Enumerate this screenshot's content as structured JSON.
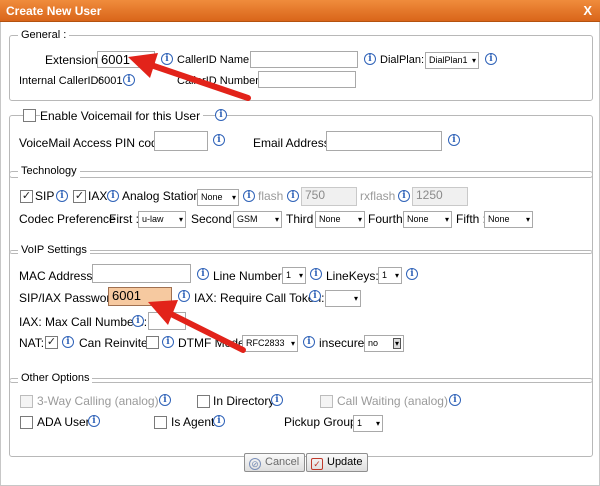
{
  "window": {
    "title": "Create New User",
    "close": "X"
  },
  "general": {
    "legend": "General :",
    "extension_label": "Extension:",
    "extension_value": "6001",
    "callerid_name_label": "CallerID Name:",
    "callerid_name_value": "",
    "dialplan_label": "DialPlan:",
    "dialplan_value": "DialPlan1",
    "internal_callerid_label": "Internal CallerID:",
    "internal_callerid_value": "6001",
    "callerid_number_label": "CallerID Number:",
    "callerid_number_value": ""
  },
  "voicemail": {
    "enable_label": "Enable Voicemail for this User",
    "pin_label": "VoiceMail Access PIN code:",
    "pin_value": "",
    "email_label": "Email Address:",
    "email_value": ""
  },
  "technology": {
    "legend": "Technology",
    "sip_label": "SIP",
    "sip_checked": true,
    "iax_label": "IAX",
    "iax_checked": true,
    "analog_label": "Analog Station:",
    "analog_value": "None",
    "flash_label": "flash",
    "flash_value": "750",
    "rxflash_label": "rxflash",
    "rxflash_value": "1250",
    "codec_label": "Codec Preference :",
    "codecs": [
      {
        "label": "First :",
        "value": "u-law"
      },
      {
        "label": "Second :",
        "value": "GSM"
      },
      {
        "label": "Third :",
        "value": "None"
      },
      {
        "label": "Fourth :",
        "value": "None"
      },
      {
        "label": "Fifth :",
        "value": "None"
      }
    ]
  },
  "voip": {
    "legend": "VoIP Settings",
    "mac_label": "MAC Address :",
    "mac_value": "",
    "line_number_label": "Line Number :",
    "line_number_value": "1",
    "linekeys_label": "LineKeys:",
    "linekeys_value": "1",
    "password_label": "SIP/IAX Password:",
    "password_value": "6001",
    "token_label": "IAX: Require Call Token:",
    "token_value": "",
    "max_calls_label": "IAX: Max Call Numbers:",
    "max_calls_value": "",
    "nat_label": "NAT:",
    "nat_checked": true,
    "reinvite_label": "Can Reinvite:",
    "reinvite_checked": false,
    "dtmf_label": "DTMF Mode:",
    "dtmf_value": "RFC2833",
    "insecure_label": "insecure:",
    "insecure_value": "no"
  },
  "other": {
    "legend": "Other Options",
    "three_way_label": "3-Way Calling (analog)",
    "in_directory_label": "In Directory",
    "call_waiting_label": "Call Waiting (analog)",
    "ada_label": "ADA User",
    "is_agent_label": "Is Agent",
    "pickup_label": "Pickup Group:",
    "pickup_value": "1"
  },
  "buttons": {
    "cancel": "Cancel",
    "update": "Update"
  },
  "colors": {
    "titlebar": "#e0742b",
    "info": "#2f62b8",
    "highlight": "#f6c9a0",
    "annotation_arrow": "#e2231a"
  },
  "icons": {
    "info": "info-icon",
    "check": "checkmark",
    "annotation": "red-arrow"
  }
}
